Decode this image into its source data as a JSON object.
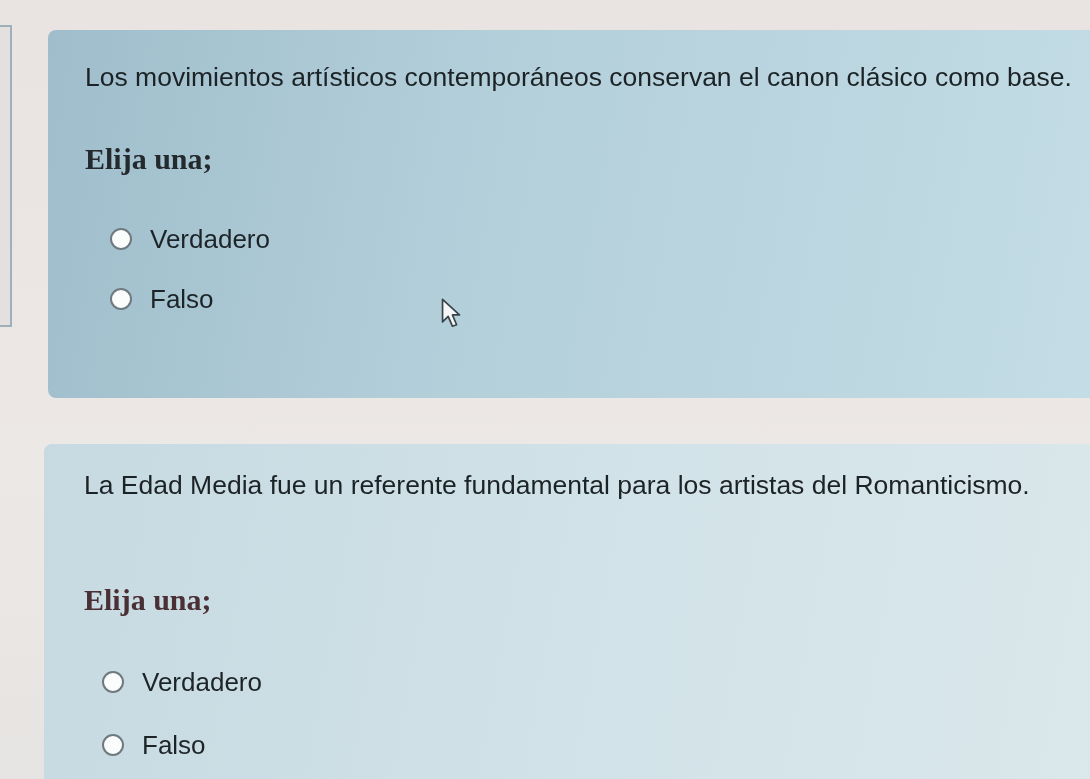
{
  "questions": [
    {
      "text": "Los movimientos artísticos contemporáneos conservan el canon clásico como base.",
      "prompt": "Elija una;",
      "options": [
        {
          "label": "Verdadero",
          "selected": false
        },
        {
          "label": "Falso",
          "selected": false
        }
      ]
    },
    {
      "text": "La Edad Media fue un referente fundamental para los artistas del Romanticismo.",
      "prompt": "Elija una;",
      "options": [
        {
          "label": "Verdadero",
          "selected": false
        },
        {
          "label": "Falso",
          "selected": false
        }
      ]
    }
  ]
}
